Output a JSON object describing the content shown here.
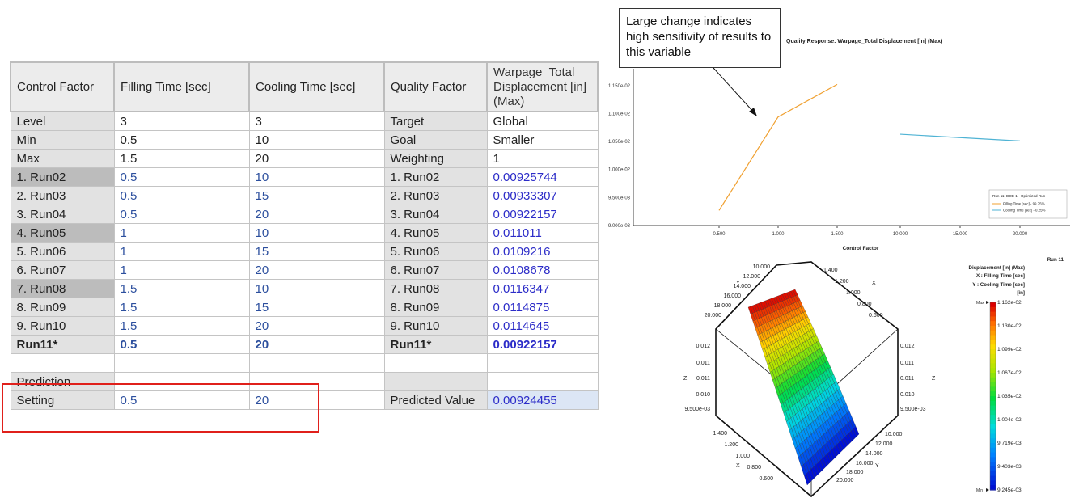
{
  "table": {
    "header": {
      "c1": "Control Factor",
      "c2": "Filling Time [sec]",
      "c3": "Cooling Time [sec]",
      "c4": "Quality Factor",
      "c5": "Warpage_Total Displacement [in] (Max)"
    },
    "rows": [
      {
        "c1": "Level",
        "c2": "3",
        "c3": "3",
        "c4": "Target",
        "c5": "Global"
      },
      {
        "c1": "Min",
        "c2": "0.5",
        "c3": "10",
        "c4": "Goal",
        "c5": "Smaller"
      },
      {
        "c1": "Max",
        "c2": "1.5",
        "c3": "20",
        "c4": "Weighting",
        "c5": "1"
      },
      {
        "c1": "1. Run02",
        "c2": "0.5",
        "c3": "10",
        "c4": "1. Run02",
        "c5": "0.00925744"
      },
      {
        "c1": "2. Run03",
        "c2": "0.5",
        "c3": "15",
        "c4": "2. Run03",
        "c5": "0.00933307"
      },
      {
        "c1": "3. Run04",
        "c2": "0.5",
        "c3": "20",
        "c4": "3. Run04",
        "c5": "0.00922157"
      },
      {
        "c1": "4. Run05",
        "c2": "1",
        "c3": "10",
        "c4": "4. Run05",
        "c5": "0.011011"
      },
      {
        "c1": "5. Run06",
        "c2": "1",
        "c3": "15",
        "c4": "5. Run06",
        "c5": "0.0109216"
      },
      {
        "c1": "6. Run07",
        "c2": "1",
        "c3": "20",
        "c4": "6. Run07",
        "c5": "0.0108678"
      },
      {
        "c1": "7. Run08",
        "c2": "1.5",
        "c3": "10",
        "c4": "7. Run08",
        "c5": "0.0116347"
      },
      {
        "c1": "8. Run09",
        "c2": "1.5",
        "c3": "15",
        "c4": "8. Run09",
        "c5": "0.0114875"
      },
      {
        "c1": "9. Run10",
        "c2": "1.5",
        "c3": "20",
        "c4": "9. Run10",
        "c5": "0.0114645"
      },
      {
        "c1": "Run11*",
        "c2": "0.5",
        "c3": "20",
        "c4": "Run11*",
        "c5": "0.00922157"
      },
      {
        "c1": "",
        "c2": "",
        "c3": "",
        "c4": "",
        "c5": ""
      },
      {
        "c1": "Prediction",
        "c2": "",
        "c3": "",
        "c4": "",
        "c5": ""
      },
      {
        "c1": "Setting",
        "c2": "0.5",
        "c3": "20",
        "c4": "Predicted Value",
        "c5": "0.00924455"
      }
    ]
  },
  "callout": {
    "text": "Large change indicates high sensitivity of results to this variable"
  },
  "chart_data": [
    {
      "type": "line",
      "title": "Quality Response: Warpage_Total Displacement [in] (Max)",
      "xlabel": "Control Factor",
      "ylabel": "",
      "x_ticks": [
        "0.500",
        "1.000",
        "1.500",
        "10.000",
        "15.000",
        "20.000"
      ],
      "y_ticks": [
        "9.000e-03",
        "9.500e-03",
        "1.000e-02",
        "1.050e-02",
        "1.100e-02",
        "1.150e-02"
      ],
      "ylim": [
        0.009,
        0.0118
      ],
      "legend_title": "Run 11: DOE 1 - Optimized Run",
      "legend_position": "right",
      "series": [
        {
          "name": "Filling Time [sec] - 99.75%",
          "color": "#f0a030",
          "x": [
            0.5,
            1.0,
            1.5
          ],
          "y": [
            0.00927,
            0.01094,
            0.01152
          ]
        },
        {
          "name": "Cooling Time [sec] - 0.25%",
          "color": "#4fb3d4",
          "x": [
            10,
            15,
            20
          ],
          "y": [
            0.01063,
            0.01057,
            0.01051
          ]
        }
      ]
    },
    {
      "type": "heatmap",
      "subtype": "3d-surface",
      "title": "Run 11",
      "z_label": "Z : Warpage_Total Displacement [in] (Max)",
      "x_label": "X : Filling Time [sec]",
      "y_label": "Y : Cooling Time [sec]",
      "unit": "[in]",
      "x_ticks": [
        "0.600",
        "0.800",
        "1.000",
        "1.200",
        "1.400"
      ],
      "y_ticks": [
        "10.000",
        "12.000",
        "14.000",
        "16.000",
        "18.000",
        "20.000"
      ],
      "z_ticks": [
        "9.500e-03",
        "0.010",
        "0.011",
        "0.011",
        "0.012"
      ],
      "axis_letters": {
        "x": "X",
        "y": "Y",
        "z": "Z"
      },
      "colorbar_max_label": "Max",
      "colorbar_min_label": "Min",
      "colorbar_values": [
        "1.162e-02",
        "1.130e-02",
        "1.099e-02",
        "1.067e-02",
        "1.035e-02",
        "1.004e-02",
        "9.719e-03",
        "9.403e-03",
        "9.245e-03"
      ]
    }
  ]
}
